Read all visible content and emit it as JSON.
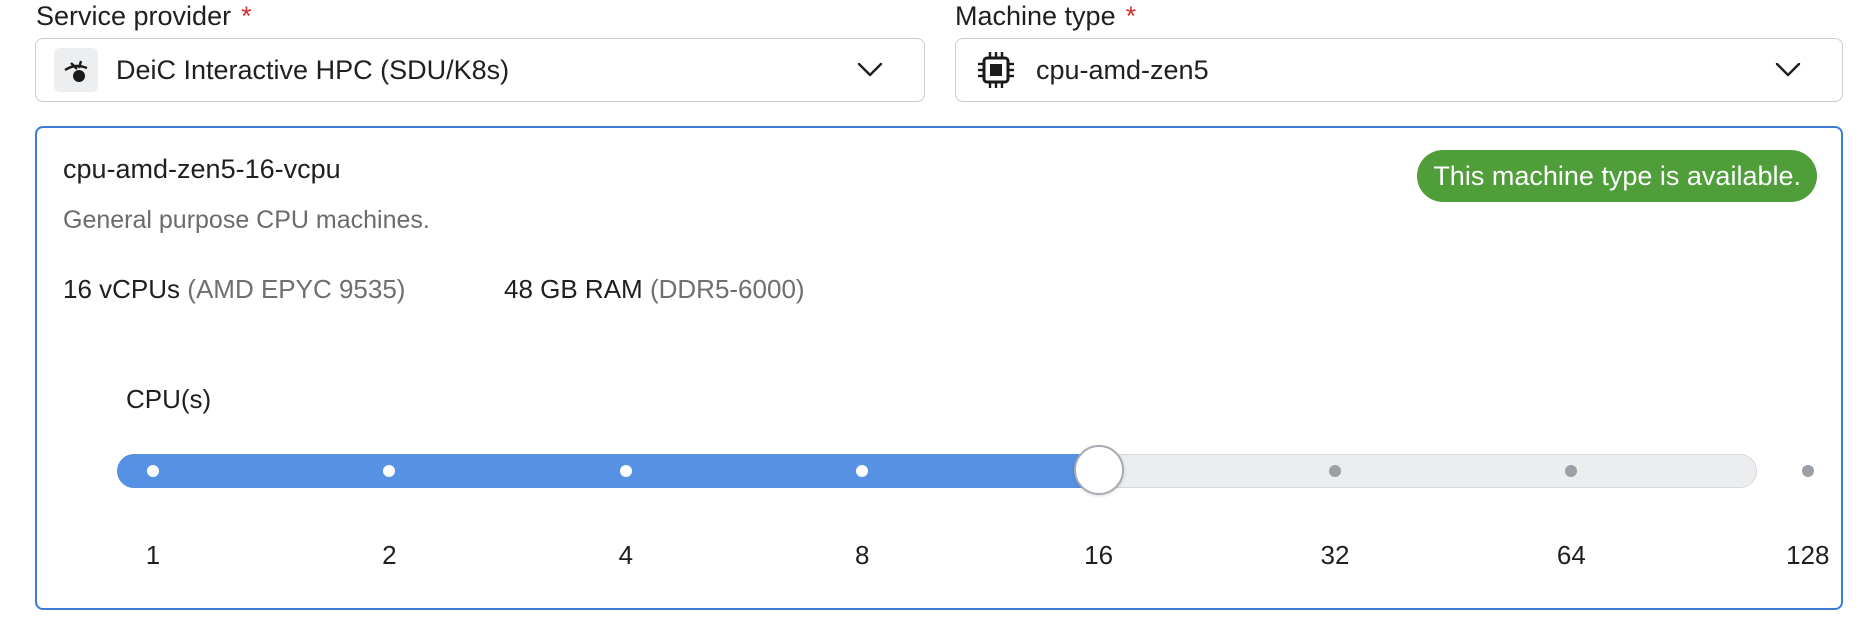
{
  "service_provider": {
    "label": "Service provider",
    "required_mark": "*",
    "value": "DeiC Interactive HPC (SDU/K8s)",
    "icon": "provider-logo-icon"
  },
  "machine_type": {
    "label": "Machine type",
    "required_mark": "*",
    "value": "cpu-amd-zen5",
    "icon": "cpu-chip-icon"
  },
  "machine_card": {
    "name": "cpu-amd-zen5-16-vcpu",
    "description": "General purpose CPU machines.",
    "availability": "This machine type is available.",
    "cpu_value": "16 vCPUs",
    "cpu_detail": "(AMD EPYC 9535)",
    "ram_value": "48 GB RAM",
    "ram_detail": "(DDR5-6000)"
  },
  "cpu_slider": {
    "label": "CPU(s)",
    "ticks": [
      "1",
      "2",
      "4",
      "8",
      "16",
      "32",
      "64",
      "128"
    ],
    "selected": "16",
    "selected_index": 4
  },
  "colors": {
    "accent": "#5691e3",
    "card_border": "#3d7bd6",
    "available_badge": "#4f9e3a",
    "required": "#d32f2f"
  }
}
